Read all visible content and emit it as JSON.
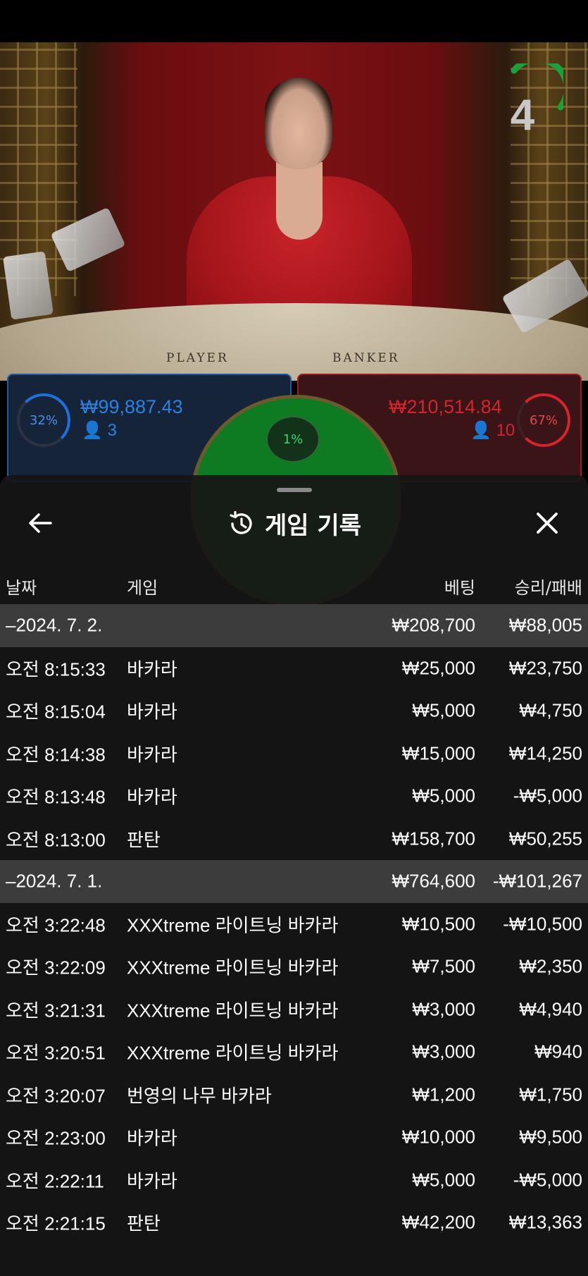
{
  "game": {
    "timer": "4",
    "table_labels": {
      "player": "PLAYER",
      "banker": "BANKER"
    },
    "player": {
      "percent": "32%",
      "amount": "₩99,887.43",
      "count": "3"
    },
    "banker": {
      "percent": "67%",
      "amount": "₩210,514.84",
      "count": "10"
    },
    "tie": {
      "percent": "1%"
    }
  },
  "sheet": {
    "title": "게임 기록",
    "icons": {
      "back": "arrow-left-icon",
      "history": "history-icon",
      "close": "close-icon"
    },
    "columns": {
      "date": "날짜",
      "game": "게임",
      "bet": "베팅",
      "result": "승리/패배"
    },
    "rows": [
      {
        "type": "group",
        "time": "–2024. 7. 2.",
        "game": "",
        "bet": "₩208,700",
        "result": "₩88,005"
      },
      {
        "type": "item",
        "time": "오전 8:15:33",
        "game": "바카라",
        "bet": "₩25,000",
        "result": "₩23,750"
      },
      {
        "type": "item",
        "time": "오전 8:15:04",
        "game": "바카라",
        "bet": "₩5,000",
        "result": "₩4,750"
      },
      {
        "type": "item",
        "time": "오전 8:14:38",
        "game": "바카라",
        "bet": "₩15,000",
        "result": "₩14,250"
      },
      {
        "type": "item",
        "time": "오전 8:13:48",
        "game": "바카라",
        "bet": "₩5,000",
        "result": "-₩5,000"
      },
      {
        "type": "item",
        "time": "오전 8:13:00",
        "game": "판탄",
        "bet": "₩158,700",
        "result": "₩50,255"
      },
      {
        "type": "group",
        "time": "–2024. 7. 1.",
        "game": "",
        "bet": "₩764,600",
        "result": "-₩101,267"
      },
      {
        "type": "item",
        "time": "오전 3:22:48",
        "game": "XXXtreme 라이트닝 바카라",
        "bet": "₩10,500",
        "result": "-₩10,500"
      },
      {
        "type": "item",
        "time": "오전 3:22:09",
        "game": "XXXtreme 라이트닝 바카라",
        "bet": "₩7,500",
        "result": "₩2,350"
      },
      {
        "type": "item",
        "time": "오전 3:21:31",
        "game": "XXXtreme 라이트닝 바카라",
        "bet": "₩3,000",
        "result": "₩4,940"
      },
      {
        "type": "item",
        "time": "오전 3:20:51",
        "game": "XXXtreme 라이트닝 바카라",
        "bet": "₩3,000",
        "result": "₩940"
      },
      {
        "type": "item",
        "time": "오전 3:20:07",
        "game": "번영의 나무 바카라",
        "bet": "₩1,200",
        "result": "₩1,750"
      },
      {
        "type": "item",
        "time": "오전 2:23:00",
        "game": "바카라",
        "bet": "₩10,000",
        "result": "₩9,500"
      },
      {
        "type": "item",
        "time": "오전 2:22:11",
        "game": "바카라",
        "bet": "₩5,000",
        "result": "-₩5,000"
      },
      {
        "type": "item",
        "time": "오전 2:21:15",
        "game": "판탄",
        "bet": "₩42,200",
        "result": "₩13,363"
      }
    ]
  }
}
